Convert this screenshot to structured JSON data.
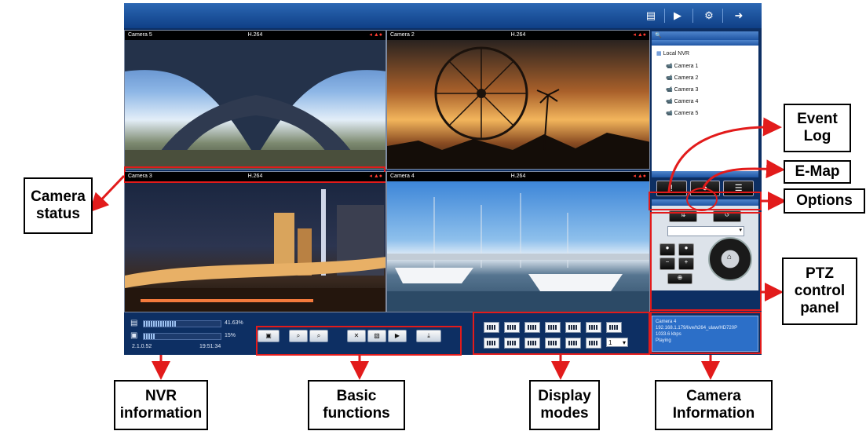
{
  "header": {
    "icons": [
      "monitor-icon",
      "play-icon",
      "settings-icon",
      "exit-icon"
    ]
  },
  "cameras": [
    {
      "name": "Camera 5",
      "codec": "H.264",
      "status": "◂ ▲●"
    },
    {
      "name": "Camera 2",
      "codec": "H.264",
      "status": "◂ ▲●"
    },
    {
      "name": "Camera 3",
      "codec": "H.264",
      "status": "◂ ▲●"
    },
    {
      "name": "Camera 4",
      "codec": "H.264",
      "status": "◂ ▲●"
    }
  ],
  "tree": {
    "root": "Local NVR",
    "items": [
      "Camera 1",
      "Camera 2",
      "Camera 3",
      "Camera 4",
      "Camera 5"
    ]
  },
  "nvr": {
    "cpu_percent": "41.63%",
    "cpu_level": 0.42,
    "mem_percent": "15%",
    "mem_level": 0.15,
    "version": "2.1.0.52",
    "time": "19:51:34"
  },
  "camera_info": {
    "name": "Camera 4",
    "url": "192.168.1.179/live/h264_ulaw/HD720P",
    "rate": "1033.6 kbps",
    "state": "Playing"
  },
  "display": {
    "select_value": "1"
  },
  "annotations": {
    "camera_status": "Camera status",
    "event_log": "Event Log",
    "emap": "E-Map",
    "options": "Options",
    "ptz": "PTZ control panel",
    "nvr_info": "NVR information",
    "basic": "Basic functions",
    "display_modes": "Display modes",
    "camera_info": "Camera Information"
  }
}
